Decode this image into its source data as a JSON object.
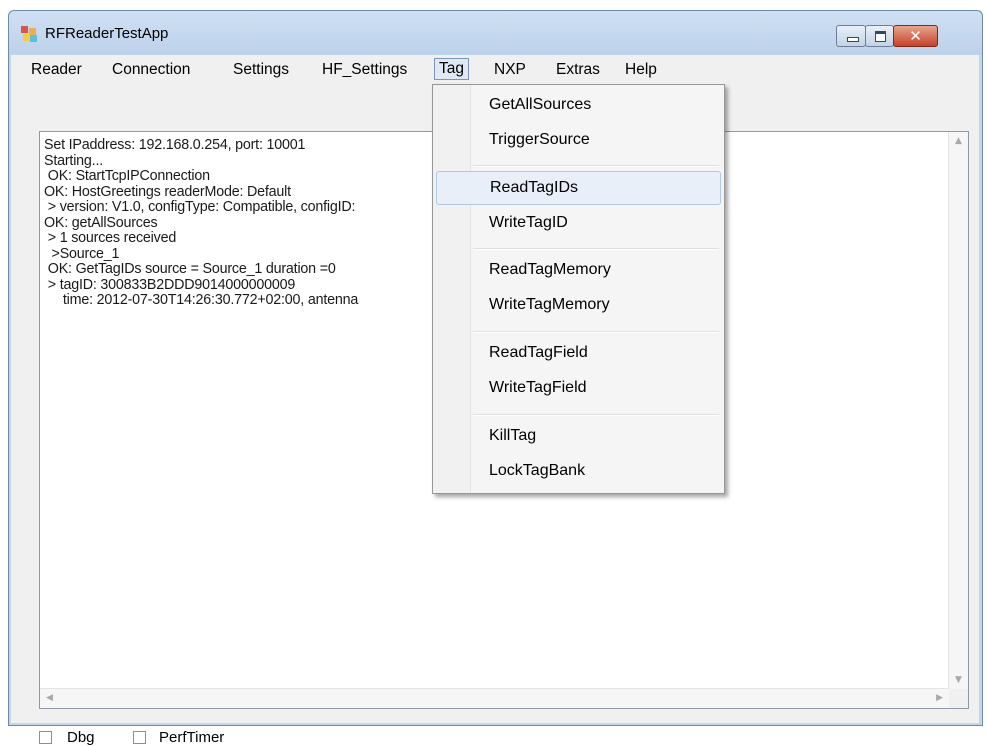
{
  "window": {
    "title": "RFReaderTestApp"
  },
  "menu": {
    "items": [
      "Reader",
      "Connection",
      "Settings",
      "HF_Settings",
      "Tag",
      "NXP",
      "Extras",
      "Help"
    ],
    "active": "Tag"
  },
  "tag_menu": {
    "groups": [
      [
        "GetAllSources",
        "TriggerSource"
      ],
      [
        "ReadTagIDs",
        "WriteTagID"
      ],
      [
        "ReadTagMemory",
        "WriteTagMemory"
      ],
      [
        "ReadTagField",
        "WriteTagField"
      ],
      [
        "KillTag",
        "LockTagBank"
      ]
    ],
    "highlighted": "ReadTagIDs"
  },
  "log": {
    "lines": [
      "Set IPaddress: 192.168.0.254, port: 10001",
      "Starting...",
      " OK: StartTcpIPConnection",
      "OK: HostGreetings readerMode: Default",
      " > version: V1.0, configType: Compatible, configID:",
      "OK: getAllSources",
      " > 1 sources received",
      "  >Source_1",
      " OK: GetTagIDs source = Source_1 duration =0",
      " > tagID: 300833B2DDD9014000000009",
      "     time: 2012-07-30T14:26:30.772+02:00, antenna"
    ]
  },
  "options": {
    "dbg_label": "Dbg",
    "dbg_checked": false,
    "perftimer_label": "PerfTimer",
    "perftimer_checked": false
  },
  "icons": {
    "app": "app-icon",
    "minimize": "minimize-icon",
    "maximize": "maximize-icon",
    "close": "close-icon"
  }
}
